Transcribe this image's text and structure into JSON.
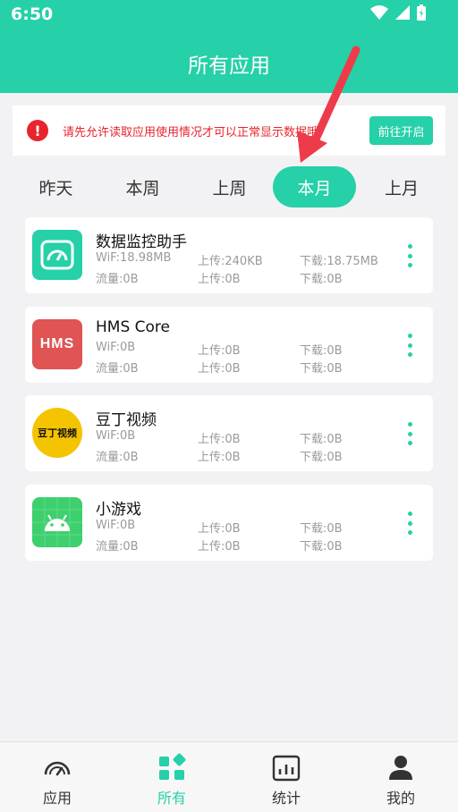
{
  "status_bar": {
    "time": "6:50",
    "icons": [
      "wifi-icon",
      "signal-icon",
      "battery-icon"
    ]
  },
  "header": {
    "title": "所有应用"
  },
  "notice": {
    "icon": "alert-icon",
    "text": "请先允许读取应用使用情况才可以正常显示数据哦",
    "button_label": "前往开启"
  },
  "tabs": [
    {
      "label": "昨天",
      "active": false
    },
    {
      "label": "本周",
      "active": false
    },
    {
      "label": "上周",
      "active": false
    },
    {
      "label": "本月",
      "active": true
    },
    {
      "label": "上月",
      "active": false
    }
  ],
  "apps": [
    {
      "name": "数据监控助手",
      "icon": "speedometer-icon",
      "wifi": "WiF:18.98MB",
      "wifi_upload": "上传:240KB",
      "wifi_download": "下载:18.75MB",
      "traffic": "流量:0B",
      "traffic_upload": "上传:0B",
      "traffic_download": "下载:0B"
    },
    {
      "name": "HMS Core",
      "icon": "hms-core-icon",
      "icon_text": "HMS",
      "wifi": "WiF:0B",
      "wifi_upload": "上传:0B",
      "wifi_download": "下载:0B",
      "traffic": "流量:0B",
      "traffic_upload": "上传:0B",
      "traffic_download": "下载:0B"
    },
    {
      "name": "豆丁视频",
      "icon": "douding-video-icon",
      "icon_text": "豆丁视频",
      "wifi": "WiF:0B",
      "wifi_upload": "上传:0B",
      "wifi_download": "下载:0B",
      "traffic": "流量:0B",
      "traffic_upload": "上传:0B",
      "traffic_download": "下载:0B"
    },
    {
      "name": "小游戏",
      "icon": "android-icon",
      "wifi": "WiF:0B",
      "wifi_upload": "上传:0B",
      "wifi_download": "下载:0B",
      "traffic": "流量:0B",
      "traffic_upload": "上传:0B",
      "traffic_download": "下载:0B"
    }
  ],
  "bottom_nav": [
    {
      "label": "应用",
      "icon": "gauge-icon",
      "active": false
    },
    {
      "label": "所有",
      "icon": "grid-icon",
      "active": true
    },
    {
      "label": "统计",
      "icon": "chart-icon",
      "active": false
    },
    {
      "label": "我的",
      "icon": "user-icon",
      "active": false
    }
  ],
  "colors": {
    "accent": "#26d0a8",
    "alert": "#e8242c",
    "background": "#f2f2f4"
  }
}
